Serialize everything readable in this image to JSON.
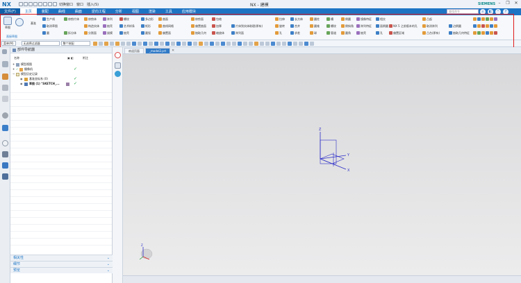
{
  "app": {
    "logo": "NX",
    "title": "NX - 建模",
    "brand": "SIEMENS"
  },
  "quick_access": {
    "switch_window": "切换窗口",
    "window": "窗口",
    "insert": "插入(S)"
  },
  "menu": {
    "file_label": "文件(F)",
    "tabs": [
      "主页",
      "装配",
      "曲线",
      "曲面",
      "逆向工程",
      "分析",
      "视图",
      "渲染",
      "工具",
      "应用模块"
    ],
    "active_tab": 0,
    "search_placeholder": "查找命令"
  },
  "ribbon": {
    "sketch_label": "草图",
    "datum_label": "基准",
    "group_name": "直接草图",
    "columns": [
      [
        "生产线",
        "取消草图",
        "圆"
      ],
      [
        "修剪片体",
        "拆分体"
      ],
      [
        "修剪体",
        "构造实体",
        "分割面"
      ],
      [
        "阵列",
        "抽壳",
        "拔模"
      ],
      [
        "螺纹",
        "艺术样条",
        "抽壳"
      ],
      [
        "多边形",
        "矩形",
        "圆弧"
      ],
      [
        "曲面",
        "曲线网格",
        "偏置面"
      ],
      [
        "修剪面",
        "偏置曲面",
        "抽取几何"
      ],
      [
        "包络",
        "加厚",
        "缩放体"
      ],
      [
        "片体到实体助理(原有)",
        "阵列面"
      ],
      [
        "拉伸",
        "旋转",
        "孔"
      ],
      [
        "长方体",
        "合并",
        "求差"
      ],
      [
        "圆柱",
        "圆锥",
        "球"
      ],
      [
        "槽",
        "螺纹",
        "管道"
      ],
      [
        "倒圆",
        "倒斜角",
        "圆角"
      ],
      [
        "镜像特征",
        "阵列特征",
        "抽壳"
      ],
      [
        "相交",
        "面倒圆",
        "孔"
      ],
      [
        "NX 5 之前版本的孔",
        "偏置区域"
      ],
      [
        "凸起",
        "取消阵列",
        "凸台(原有)"
      ],
      [
        "抽取几何特征",
        "边倒圆"
      ]
    ]
  },
  "selection_bar": {
    "menu_label": "菜单(M)",
    "filter": "无选择过滤器",
    "scope": "整个装配"
  },
  "doc_tabs": [
    "欢迎页面",
    "_model2.prt"
  ],
  "navigator": {
    "title": "部件导航器",
    "columns": [
      "名称",
      "附注"
    ],
    "rows": [
      {
        "label": "模型视图",
        "check": ""
      },
      {
        "label": "摄像机",
        "check": "✓"
      },
      {
        "label": "模型历史记录",
        "check": ""
      },
      {
        "label": "基准坐标系 (0)",
        "check": "✓"
      },
      {
        "label": "草图 (1) \"SKETCH_...",
        "check": "✓"
      }
    ],
    "bottom_panels": [
      "相关性",
      "细节",
      "预览"
    ]
  },
  "viewport": {
    "axis_labels": {
      "x": "X",
      "y": "Y",
      "z": "Z"
    },
    "triad_labels": {
      "z": "Z"
    }
  },
  "colors": {
    "accent": "#1d74c4",
    "frame": "#e01a1a",
    "axis": "#2b2bc8",
    "check": "#19a13c"
  }
}
